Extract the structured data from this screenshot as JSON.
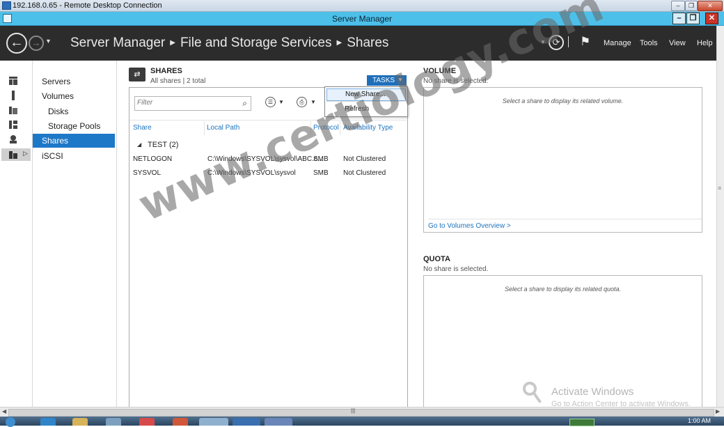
{
  "rdp": {
    "title": "192.168.0.65 - Remote Desktop Connection"
  },
  "window": {
    "title": "Server Manager"
  },
  "header": {
    "breadcrumb": [
      "Server Manager",
      "File and Storage Services",
      "Shares"
    ],
    "menu": [
      "Manage",
      "Tools",
      "View",
      "Help"
    ]
  },
  "nav": {
    "items": [
      {
        "label": "Servers",
        "selected": false
      },
      {
        "label": "Volumes",
        "selected": false
      },
      {
        "label": "Disks",
        "selected": false
      },
      {
        "label": "Storage Pools",
        "selected": false
      },
      {
        "label": "Shares",
        "selected": true
      },
      {
        "label": "iSCSI",
        "selected": false
      }
    ]
  },
  "shares": {
    "title": "SHARES",
    "subtitle": "All shares | 2 total",
    "tasks_label": "TASKS",
    "filter_placeholder": "Filter",
    "columns": [
      "Share",
      "Local Path",
      "Protocol",
      "Availability Type"
    ],
    "group": "TEST (2)",
    "rows": [
      {
        "share": "NETLOGON",
        "path": "C:\\Windows\\SYSVOL\\sysvol\\ABC.c...",
        "protocol": "SMB",
        "availability": "Not Clustered"
      },
      {
        "share": "SYSVOL",
        "path": "C:\\Windows\\SYSVOL\\sysvol",
        "protocol": "SMB",
        "availability": "Not Clustered"
      }
    ],
    "tasks_menu": [
      "New Share...",
      "Refresh"
    ]
  },
  "volume": {
    "title": "VOLUME",
    "subtitle": "No share is selected.",
    "message": "Select a share to display its related volume.",
    "link": "Go to Volumes Overview >"
  },
  "quota": {
    "title": "QUOTA",
    "subtitle": "No share is selected.",
    "message": "Select a share to display its related quota."
  },
  "activation": {
    "title": "Activate Windows",
    "subtitle": "Go to Action Center to activate Windows."
  },
  "taskbar": {
    "time": "1:00 AM"
  },
  "watermark": "www.certiology.com",
  "colors": {
    "accent": "#1e78c8",
    "titlebar": "#4dc0e9",
    "header": "#2c2c2c",
    "link": "#1e73be"
  },
  "icons": [
    "back-arrow-icon",
    "forward-arrow-icon",
    "refresh-icon",
    "flag-icon",
    "search-icon",
    "list-options-icon",
    "save-query-icon",
    "shares-icon",
    "key-icon"
  ]
}
